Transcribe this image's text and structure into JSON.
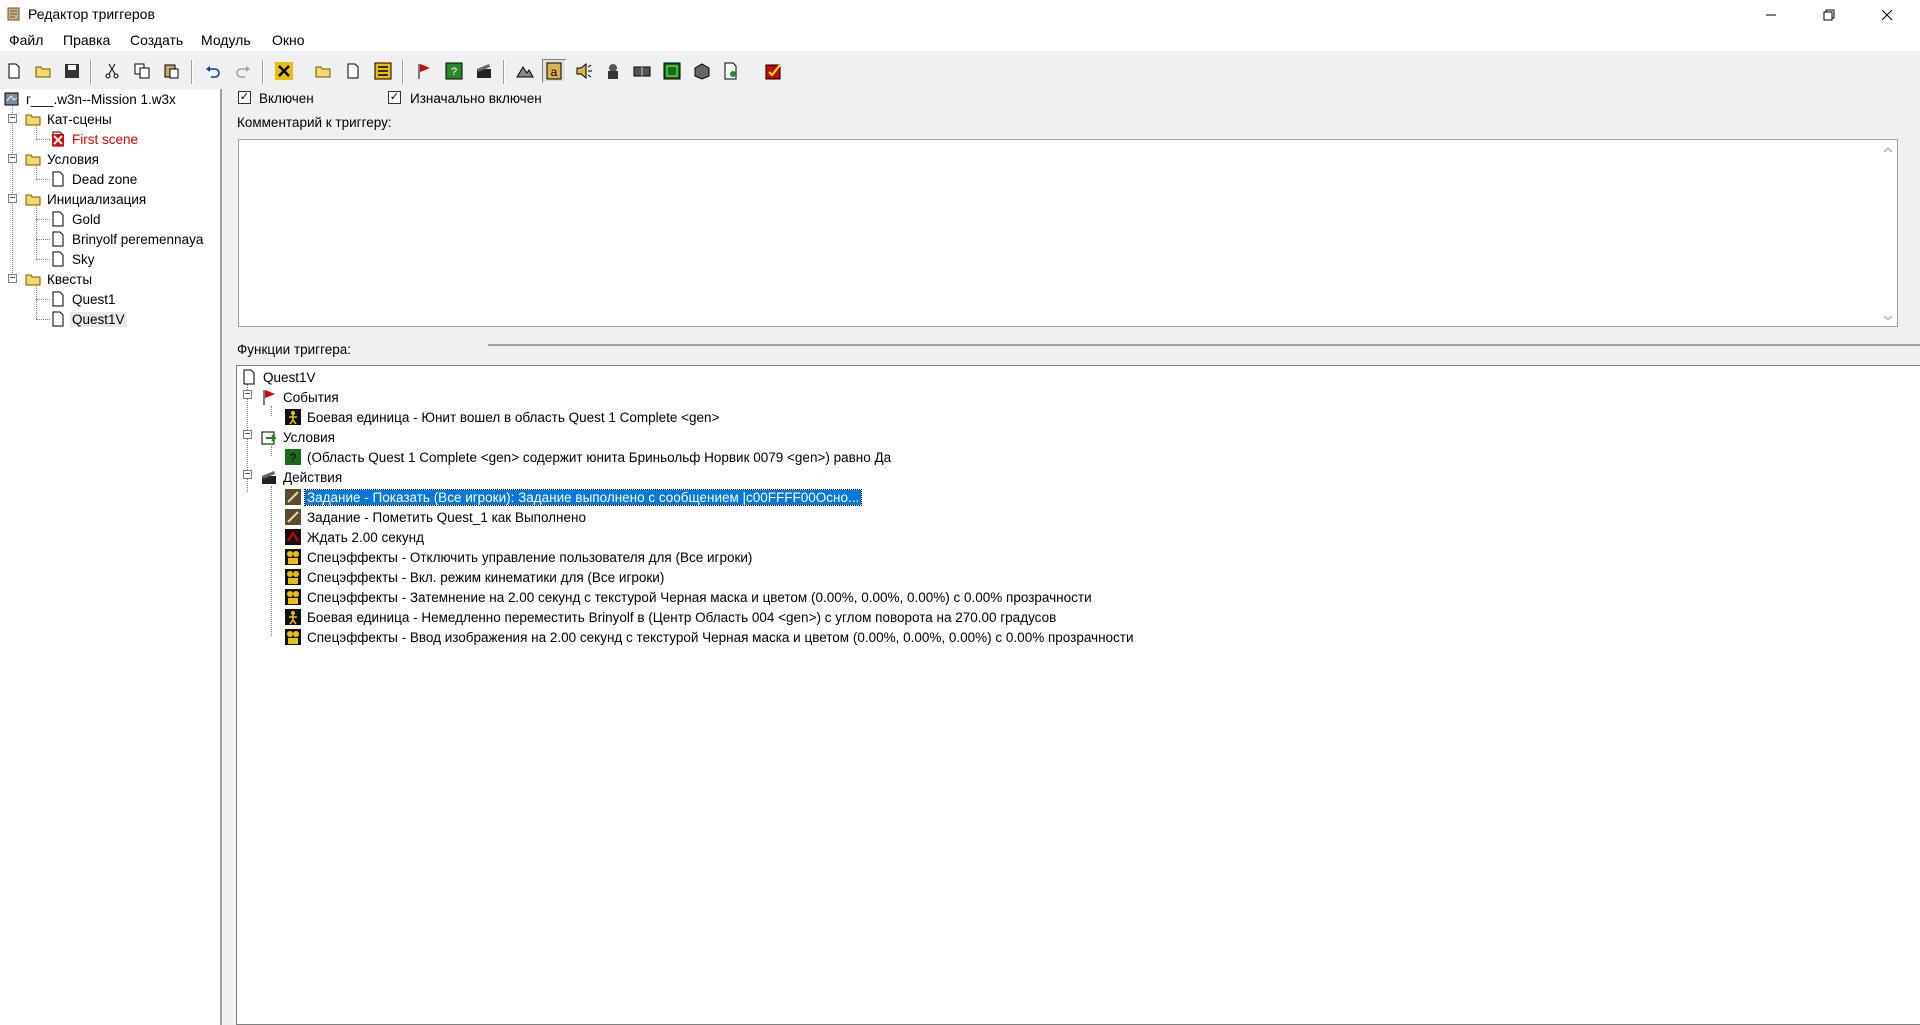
{
  "window": {
    "title": "Редактор триггеров",
    "controls": {
      "minimize": "—",
      "maximize": "❐",
      "close": "✕"
    }
  },
  "menu": [
    "Файл",
    "Правка",
    "Создать",
    "Модуль",
    "Окно"
  ],
  "toolbar": {
    "buttons": [
      "new",
      "open",
      "save",
      "cut",
      "copy",
      "paste",
      "undo",
      "redo",
      "delete",
      "new-category",
      "new-trigger",
      "new-comment",
      "new-event",
      "new-condition",
      "new-action",
      "terrain-editor",
      "trigger-editor",
      "sound-editor",
      "object-editor",
      "campaign-editor",
      "ai-editor",
      "import-manager",
      "object-manager",
      "test-map"
    ]
  },
  "left_tree": {
    "root": "г___.w3n--Mission 1.w3x",
    "folders": [
      {
        "label": "Кат-сцены",
        "items": [
          {
            "label": "First scene",
            "disabled": true
          }
        ]
      },
      {
        "label": "Условия",
        "items": [
          {
            "label": "Dead zone"
          }
        ]
      },
      {
        "label": "Инициализация",
        "items": [
          {
            "label": "Gold"
          },
          {
            "label": "Brinyolf peremennaya"
          },
          {
            "label": "Sky"
          }
        ]
      },
      {
        "label": "Квесты",
        "items": [
          {
            "label": "Quest1"
          },
          {
            "label": "Quest1V"
          }
        ]
      }
    ]
  },
  "trigger_props": {
    "enabled_label": "Включен",
    "enabled": true,
    "initially_on_label": "Изначально включен",
    "initially_on": true,
    "comment_label": "Комментарий к триггеру:",
    "comment": "",
    "functions_label": "Функции триггера:"
  },
  "functions_tree": {
    "root": "Quest1V",
    "events_label": "События",
    "events": [
      "Боевая единица - Юнит вошел в область Quest 1 Complete <gen>"
    ],
    "conditions_label": "Условия",
    "conditions": [
      "(Область Quest 1 Complete <gen> содержит юнита Бриньольф Норвик 0079 <gen>) равно Да"
    ],
    "actions_label": "Действия",
    "actions": [
      {
        "text": "Задание - Показать (Все игроки): Задание выполнено с сообщением |c00FFFF00Осно...",
        "icon": "quest-icon",
        "selected": true
      },
      {
        "text": "Задание - Пометить Quest_1 как Выполнено",
        "icon": "quest-icon"
      },
      {
        "text": "Ждать 2.00 секунд",
        "icon": "wait-icon"
      },
      {
        "text": "Спецэффекты - Отключить управление пользователя для (Все игроки)",
        "icon": "cinematic-icon"
      },
      {
        "text": "Спецэффекты - Вкл. режим кинематики для (Все игроки)",
        "icon": "cinematic-icon"
      },
      {
        "text": "Спецэффекты - Затемнение на 2.00 секунд с текстурой Черная маска и цветом (0.00%, 0.00%, 0.00%) с 0.00% прозрачности",
        "icon": "cinematic-icon"
      },
      {
        "text": "Боевая единица - Немедленно переместить Brinyolf в (Центр Область 004 <gen>) с углом поворота на 270.00 градусов",
        "icon": "unit-icon"
      },
      {
        "text": "Спецэффекты - Ввод изображения на 2.00 секунд с текстурой Черная маска и цветом (0.00%, 0.00%, 0.00%) с 0.00% прозрачности",
        "icon": "cinematic-icon"
      }
    ]
  },
  "colors": {
    "selection": "#0078d7",
    "disabled_trigger": "#e00000",
    "folder": "#f5d76e"
  }
}
